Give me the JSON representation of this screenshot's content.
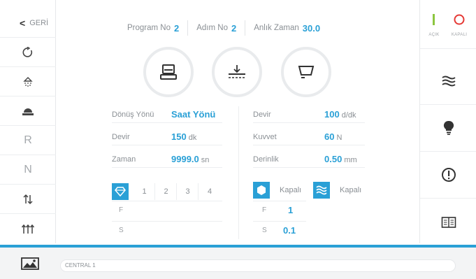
{
  "nav": {
    "back_label": "GERİ",
    "letter_r": "R",
    "letter_n": "N"
  },
  "power": {
    "on_label": "AÇIK",
    "off_label": "KAPALI",
    "on_color": "#8cc63f",
    "off_color": "#e53935"
  },
  "header": {
    "program_label": "Program No",
    "program_value": "2",
    "step_label": "Adım No",
    "step_value": "2",
    "time_label": "Anlık Zaman",
    "time_value": "30.0"
  },
  "left_params": {
    "direction_label": "Dönüş Yönü",
    "direction_value": "Saat Yönü",
    "speed_label": "Devir",
    "speed_value": "150",
    "speed_unit": "dk",
    "time_label": "Zaman",
    "time_value": "9999.0",
    "time_unit": "sn"
  },
  "right_params": {
    "speed_label": "Devir",
    "speed_value": "100",
    "speed_unit": "d/dk",
    "force_label": "Kuvvet",
    "force_value": "60",
    "force_unit": "N",
    "depth_label": "Derinlik",
    "depth_value": "0.50",
    "depth_unit": "mm"
  },
  "tools": {
    "slots": [
      "1",
      "2",
      "3",
      "4"
    ],
    "f_label": "F",
    "s_label": "S"
  },
  "pump": {
    "cover_state": "Kapalı",
    "water_state": "Kapalı",
    "f_label": "F",
    "f_value": "1",
    "s_label": "S",
    "s_value": "0.1"
  },
  "status": {
    "text": "CENTRAL 1"
  },
  "colors": {
    "accent": "#2aa0d6",
    "text": "#8a8f94"
  },
  "icons": {
    "left": [
      "chevron-left-icon",
      "rotate-icon",
      "shower-icon",
      "platform-icon",
      "up-down-arrows-icon",
      "triple-up-arrows-icon"
    ],
    "modes": [
      "polisher-icon",
      "surface-level-icon",
      "tray-icon"
    ],
    "right": [
      "waves-icon",
      "bulb-icon",
      "alert-icon",
      "manual-book-icon"
    ],
    "bottom": [
      "gallery-icon"
    ]
  }
}
